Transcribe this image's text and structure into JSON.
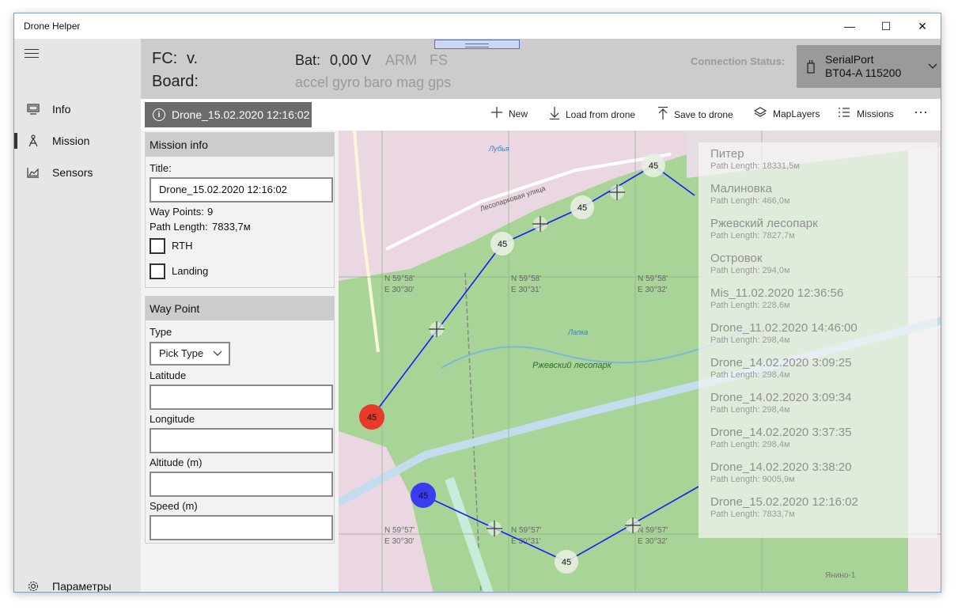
{
  "window": {
    "title": "Drone Helper",
    "minimize_glyph": "—",
    "maximize_glyph": "☐",
    "close_glyph": "✕"
  },
  "nav": {
    "items": [
      {
        "label": "Info",
        "icon": "monitor-icon"
      },
      {
        "label": "Mission",
        "icon": "drone-icon",
        "active": true
      },
      {
        "label": "Sensors",
        "icon": "chart-icon"
      }
    ],
    "settings_label": "Параметры"
  },
  "header": {
    "fc_label": "FC:",
    "fc_value": "v.",
    "board_label": "Board:",
    "bat_label": "Bat:",
    "bat_value": "0,00 V",
    "arm": "ARM",
    "fs": "FS",
    "sensors": "accel gyro baro mag gps",
    "connection_label": "Connection Status:",
    "connection_port": "SerialPort",
    "connection_detail": "BT04-A 115200"
  },
  "toolbar": {
    "mission_name": "Drone_15.02.2020 12:16:02",
    "new": "New",
    "load": "Load from drone",
    "save": "Save to drone",
    "map_layers": "MapLayers",
    "missions": "Missions",
    "more": "···"
  },
  "mission_info": {
    "heading": "Mission info",
    "title_label": "Title:",
    "title_value": "Drone_15.02.2020 12:16:02",
    "waypoints_label": "Way Points:",
    "waypoints_value": "9",
    "path_label": "Path Length:",
    "path_value": "7833,7м",
    "rth_label": "RTH",
    "rth_checked": false,
    "landing_label": "Landing",
    "landing_checked": false
  },
  "way_point": {
    "heading": "Way Point",
    "type_label": "Type",
    "type_value": "Pick Type",
    "latitude_label": "Latitude",
    "latitude_value": "",
    "longitude_label": "Longitude",
    "longitude_value": "",
    "altitude_label": "Altitude (m)",
    "altitude_value": "",
    "speed_label": "Speed (m)",
    "speed_value": ""
  },
  "map": {
    "labels": {
      "street1": "Лесопарковая улица",
      "park": "Ржевский лесопарк",
      "river": "Лапка",
      "lubya": "Лубья",
      "coord_n58": "N 59°58'",
      "coord_e30": "E 30°30'",
      "coord_e31": "E 30°31'",
      "coord_e32": "E 30°32'",
      "coord_n57": "N 59°57'",
      "yanino": "Янино-1"
    },
    "waypoint_label": "45",
    "colors": {
      "park": "#9fce8c",
      "urban": "#ead7e2",
      "route": "#1a1aff",
      "start": "#e8392b",
      "home": "#3b3bf0"
    }
  },
  "missions": [
    {
      "name": "Питер",
      "path": "Path Length: 18331,5м"
    },
    {
      "name": "Малиновка",
      "path": "Path Length: 466,0м"
    },
    {
      "name": "Ржевский лесопарк",
      "path": "Path Length: 7827,7м"
    },
    {
      "name": "Островок",
      "path": "Path Length: 294,0м"
    },
    {
      "name": "Mis_11.02.2020 12:36:56",
      "path": "Path Length: 228,6м"
    },
    {
      "name": "Drone_11.02.2020 14:46:00",
      "path": "Path Length: 298,4м"
    },
    {
      "name": "Drone_14.02.2020 3:09:25",
      "path": "Path Length: 298,4м"
    },
    {
      "name": "Drone_14.02.2020 3:09:34",
      "path": "Path Length: 298,4м"
    },
    {
      "name": "Drone_14.02.2020 3:37:35",
      "path": "Path Length: 298,4м"
    },
    {
      "name": "Drone_14.02.2020 3:38:20",
      "path": "Path Length: 9005,9м"
    },
    {
      "name": "Drone_15.02.2020 12:16:02",
      "path": "Path Length: 7833,7м"
    }
  ]
}
